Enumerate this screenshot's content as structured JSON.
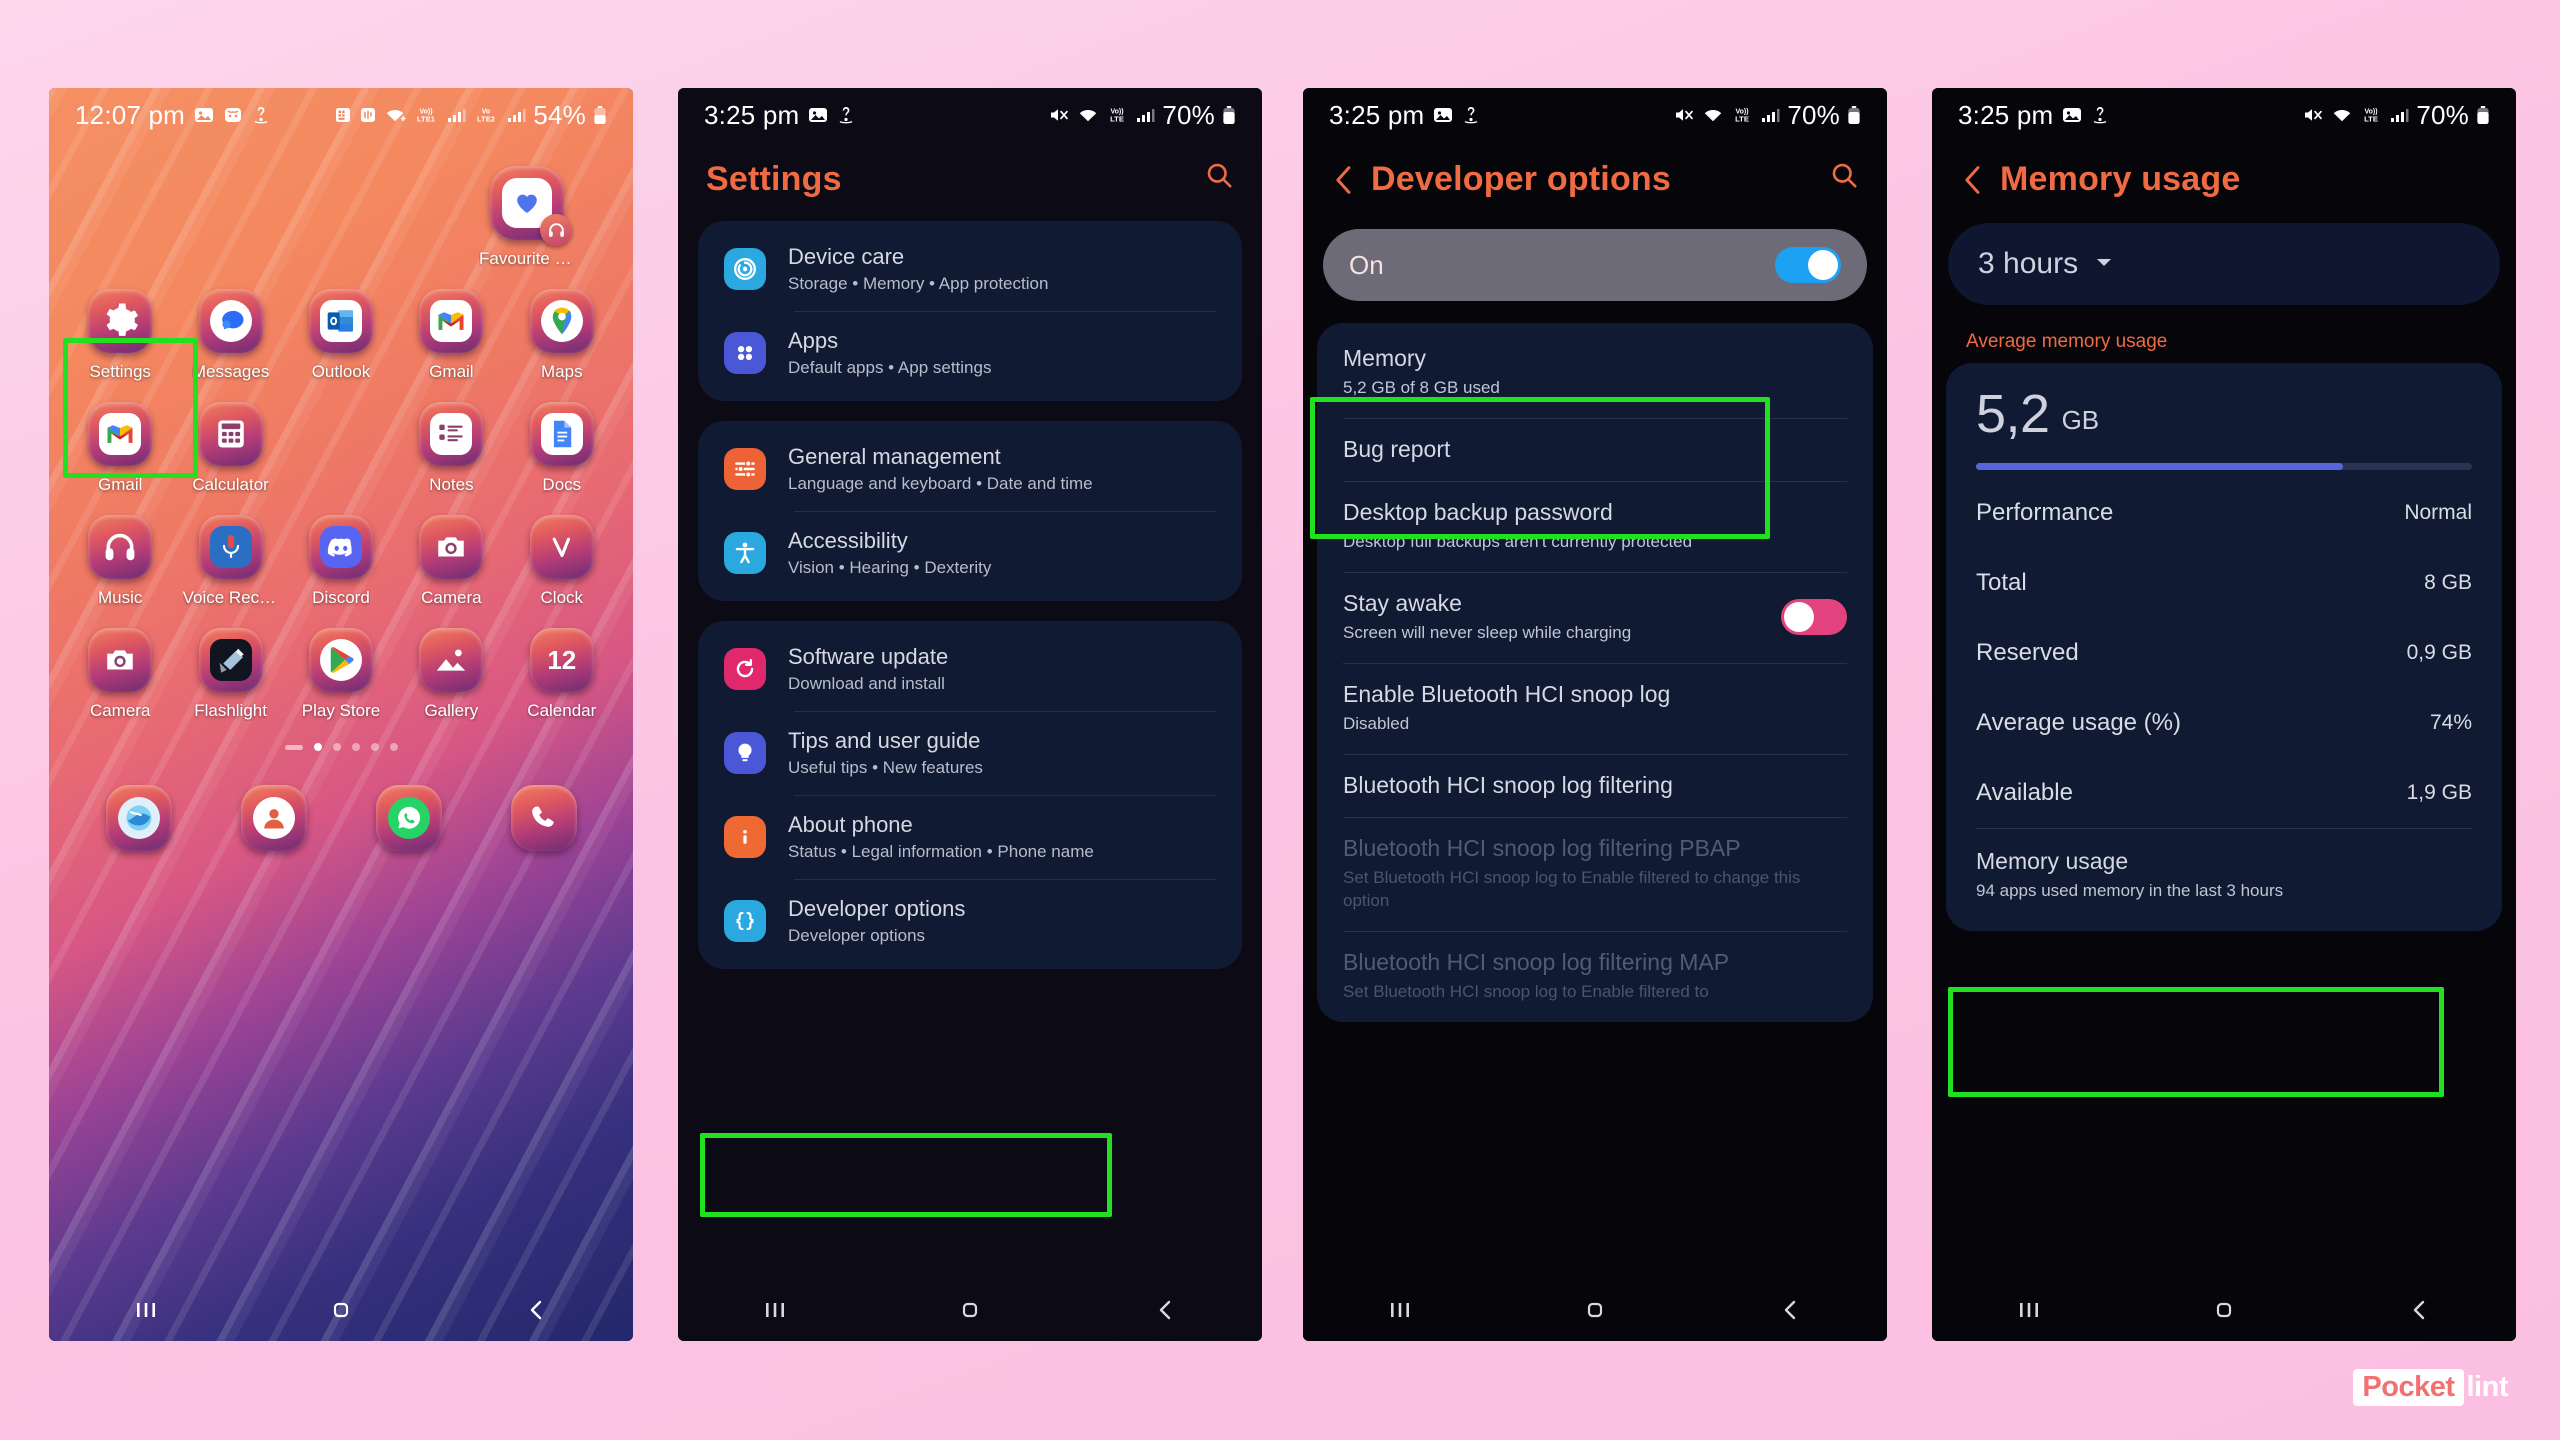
{
  "page": {
    "background_color": "#fbc3e2",
    "watermark": {
      "brand_boxed": "Pocket",
      "brand_rest": "lint"
    }
  },
  "phone1": {
    "name": "home-screen",
    "status_bar": {
      "time": "12:07 pm",
      "left_icons": [
        "photo-icon",
        "mask-icon",
        "dolby-icon"
      ],
      "right_icons": [
        "sim-icon",
        "nfc-icon",
        "wifi-icon",
        "volte1-icon",
        "signal1-icon",
        "volte2-icon",
        "signal2-icon"
      ],
      "battery_percent": "54%",
      "battery_icon": "battery-icon"
    },
    "widget": {
      "label": "Favourite tr...",
      "icon": "heart-icon",
      "badge_icon": "headphones-icon"
    },
    "apps_row1": [
      {
        "label": "Settings",
        "icon": "gear-icon"
      },
      {
        "label": "Messages",
        "icon": "chat-bubble-icon"
      },
      {
        "label": "Outlook",
        "icon": "outlook-icon"
      },
      {
        "label": "Gmail",
        "icon": "gmail-icon"
      },
      {
        "label": "Maps",
        "icon": "maps-pin-icon"
      }
    ],
    "apps_row2": [
      {
        "label": "Gmail",
        "icon": "gmail-icon"
      },
      {
        "label": "Calculator",
        "icon": "calculator-icon"
      },
      {
        "label": "",
        "icon": ""
      },
      {
        "label": "Notes",
        "icon": "notes-list-icon"
      },
      {
        "label": "Docs",
        "icon": "docs-icon"
      }
    ],
    "apps_row3": [
      {
        "label": "Music",
        "icon": "headphones-icon"
      },
      {
        "label": "Voice Recor...",
        "icon": "microphone-icon"
      },
      {
        "label": "Discord",
        "icon": "discord-icon"
      },
      {
        "label": "Camera",
        "icon": "camera-icon"
      },
      {
        "label": "Clock",
        "icon": "clock-hand-icon"
      }
    ],
    "apps_row4": [
      {
        "label": "Camera",
        "icon": "camera-icon"
      },
      {
        "label": "Flashlight",
        "icon": "flashlight-icon"
      },
      {
        "label": "Play Store",
        "icon": "play-store-icon"
      },
      {
        "label": "Gallery",
        "icon": "gallery-icon"
      },
      {
        "label": "Calendar",
        "icon": "calendar-icon",
        "day": "12"
      }
    ],
    "dock": [
      {
        "label": "Browser",
        "icon": "browser-icon"
      },
      {
        "label": "Contacts",
        "icon": "contacts-icon"
      },
      {
        "label": "WhatsApp",
        "icon": "whatsapp-icon"
      },
      {
        "label": "Phone",
        "icon": "phone-icon"
      }
    ],
    "page_indicator": {
      "pages": 6,
      "active_index": 1
    },
    "nav_bar": [
      "recents-icon",
      "home-icon",
      "back-icon"
    ]
  },
  "phone2": {
    "name": "settings-screen",
    "status_bar": {
      "time": "3:25 pm",
      "left_icons": [
        "photo-icon",
        "dolby-icon"
      ],
      "right_icons": [
        "mute-icon",
        "wifi-icon",
        "volte-icon",
        "signal-icon"
      ],
      "battery_percent": "70%"
    },
    "title": "Settings",
    "search_icon": "search-icon",
    "group1": [
      {
        "title": "Device care",
        "subtitle": "Storage  •  Memory  •  App protection",
        "icon": "device-care-icon",
        "icon_color": "#2ca8e0"
      },
      {
        "title": "Apps",
        "subtitle": "Default apps  •  App settings",
        "icon": "apps-grid-icon",
        "icon_color": "#4a58d8"
      }
    ],
    "group2": [
      {
        "title": "General management",
        "subtitle": "Language and keyboard  •  Date and time",
        "icon": "sliders-icon",
        "icon_color": "#ee6336"
      },
      {
        "title": "Accessibility",
        "subtitle": "Vision  •  Hearing  •  Dexterity",
        "icon": "accessibility-icon",
        "icon_color": "#2ca8e0"
      }
    ],
    "group3": [
      {
        "title": "Software update",
        "subtitle": "Download and install",
        "icon": "software-update-icon",
        "icon_color": "#e0296d"
      },
      {
        "title": "Tips and user guide",
        "subtitle": "Useful tips  •  New features",
        "icon": "lightbulb-icon",
        "icon_color": "#4a58d8"
      },
      {
        "title": "About phone",
        "subtitle": "Status  •  Legal information  •  Phone name",
        "icon": "info-icon",
        "icon_color": "#ef6a32"
      },
      {
        "title": "Developer options",
        "subtitle": "Developer options",
        "icon": "braces-icon",
        "icon_color": "#2ca8e0",
        "highlighted": true
      }
    ],
    "nav_bar": [
      "recents-icon",
      "home-icon",
      "back-icon"
    ]
  },
  "phone3": {
    "name": "developer-options-screen",
    "status_bar": {
      "time": "3:25 pm",
      "left_icons": [
        "photo-icon",
        "dolby-icon"
      ],
      "right_icons": [
        "mute-icon",
        "wifi-icon",
        "volte-icon",
        "signal-icon"
      ],
      "battery_percent": "70%"
    },
    "back_icon": "back-chevron-icon",
    "title": "Developer options",
    "search_icon": "search-icon",
    "master_toggle": {
      "label": "On",
      "state": "on",
      "accent": "#1da1f2"
    },
    "items": [
      {
        "title": "Memory",
        "subtitle": "5,2 GB of 8 GB used",
        "highlighted": true
      },
      {
        "title": "Bug report",
        "subtitle": ""
      },
      {
        "title": "Desktop backup password",
        "subtitle": "Desktop full backups aren't currently protected"
      },
      {
        "title": "Stay awake",
        "subtitle": "Screen will never sleep while charging",
        "toggle": "off",
        "toggle_color": "#e4427e"
      },
      {
        "title": "Enable Bluetooth HCI snoop log",
        "subtitle": "Disabled"
      },
      {
        "title": "Bluetooth HCI snoop log filtering",
        "subtitle": ""
      },
      {
        "title": "Bluetooth HCI snoop log filtering PBAP",
        "subtitle": "Set Bluetooth HCI snoop log to Enable filtered to change this option",
        "dimmed": true
      },
      {
        "title": "Bluetooth HCI snoop log filtering MAP",
        "subtitle": "Set Bluetooth HCI snoop log to Enable filtered to",
        "dimmed": true
      }
    ],
    "nav_bar": [
      "recents-icon",
      "home-icon",
      "back-icon"
    ]
  },
  "phone4": {
    "name": "memory-usage-screen",
    "status_bar": {
      "time": "3:25 pm",
      "left_icons": [
        "photo-icon",
        "dolby-icon"
      ],
      "right_icons": [
        "mute-icon",
        "wifi-icon",
        "volte-icon",
        "signal-icon"
      ],
      "battery_percent": "70%"
    },
    "back_icon": "back-chevron-icon",
    "title": "Memory usage",
    "time_range": {
      "value": "3 hours",
      "chevron": "chevron-down-icon"
    },
    "section_label": "Average memory usage",
    "average": {
      "number": "5,2",
      "unit": "GB",
      "bar_percent": 74,
      "bar_color": "#5b63d8"
    },
    "stats": [
      {
        "key": "Performance",
        "value": "Normal"
      },
      {
        "key": "Total",
        "value": "8 GB"
      },
      {
        "key": "Reserved",
        "value": "0,9 GB"
      },
      {
        "key": "Average usage (%)",
        "value": "74%"
      },
      {
        "key": "Available",
        "value": "1,9 GB"
      }
    ],
    "link_row": {
      "title": "Memory usage",
      "subtitle": "94 apps used memory in the last 3 hours",
      "highlighted": true
    },
    "nav_bar": [
      "recents-icon",
      "home-icon",
      "back-icon"
    ]
  }
}
